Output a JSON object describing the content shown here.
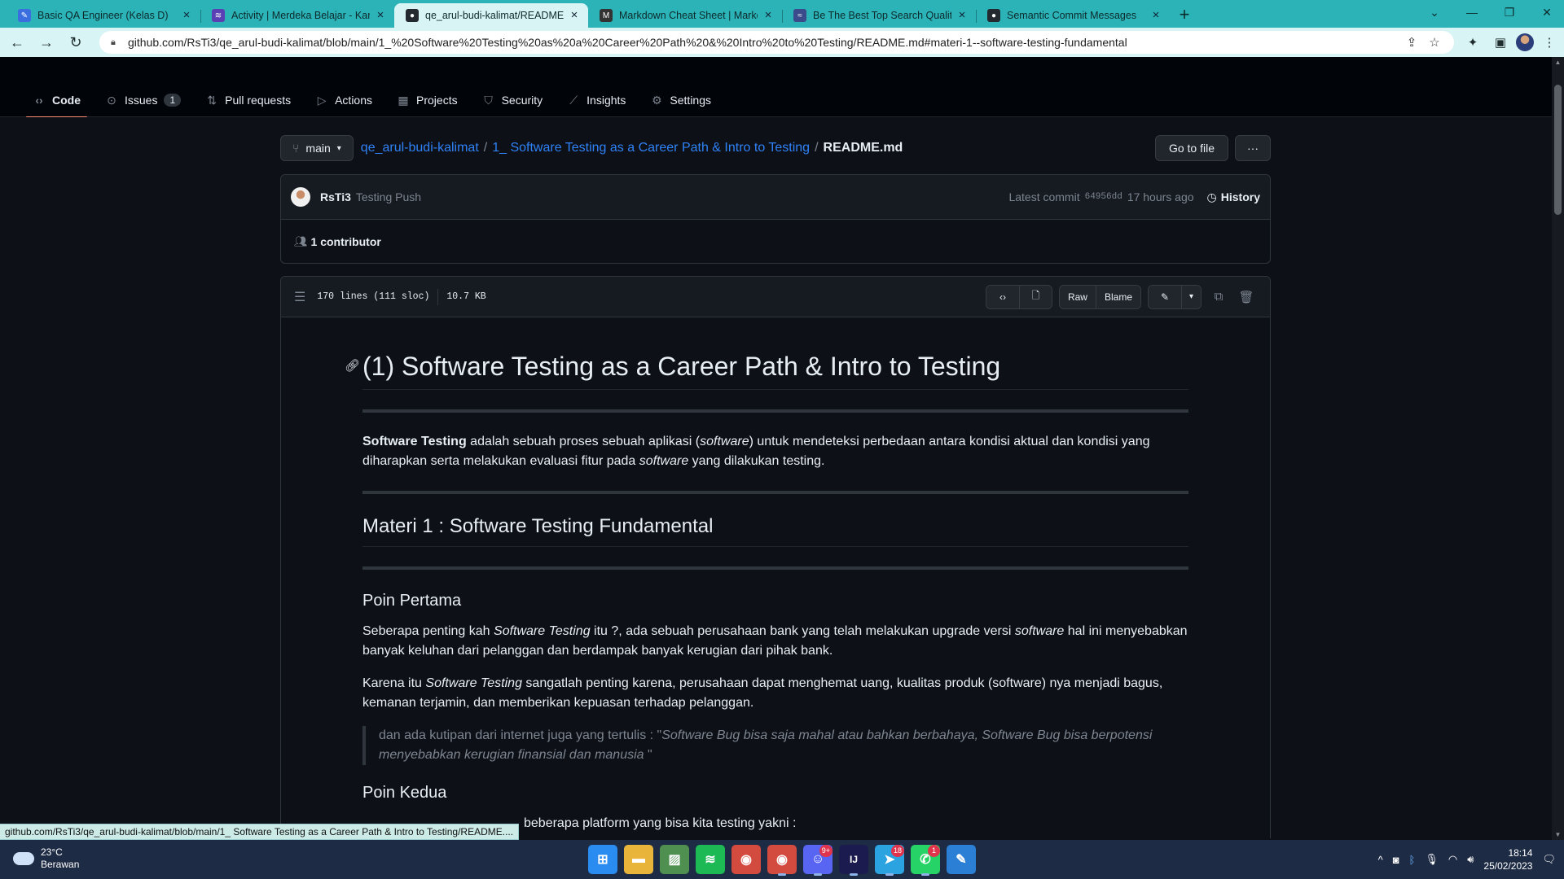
{
  "browser": {
    "tabs": [
      {
        "title": "Basic QA Engineer (Kelas D)",
        "fav": "feather-icon",
        "color": "#3b6fe0"
      },
      {
        "title": "Activity | Merdeka Belajar - Kamp",
        "fav": "mb-icon",
        "color": "#5a3fb5"
      },
      {
        "title": "qe_arul-budi-kalimat/README.m",
        "fav": "github-icon",
        "color": "#24292f",
        "active": true
      },
      {
        "title": "Markdown Cheat Sheet | Markdo",
        "fav": "markdown-icon",
        "color": "#333333"
      },
      {
        "title": "Be The Best Top Search Quality E",
        "fav": "quality-icon",
        "color": "#3a4a8a"
      },
      {
        "title": "Semantic Commit Messages",
        "fav": "github-icon",
        "color": "#24292f"
      }
    ],
    "url": "github.com/RsTi3/qe_arul-budi-kalimat/blob/main/1_%20Software%20Testing%20as%20a%20Career%20Path%20&%20Intro%20to%20Testing/README.md#materi-1--software-testing-fundamental"
  },
  "repo_nav": [
    {
      "label": "Code",
      "icon": "code-icon",
      "active": true
    },
    {
      "label": "Issues",
      "icon": "issue-icon",
      "count": "1"
    },
    {
      "label": "Pull requests",
      "icon": "pull-request-icon"
    },
    {
      "label": "Actions",
      "icon": "play-icon"
    },
    {
      "label": "Projects",
      "icon": "table-icon"
    },
    {
      "label": "Security",
      "icon": "shield-icon"
    },
    {
      "label": "Insights",
      "icon": "graph-icon"
    },
    {
      "label": "Settings",
      "icon": "gear-icon"
    }
  ],
  "file": {
    "branch": "main",
    "repo": "qe_arul-budi-kalimat",
    "folder": "1_ Software Testing as a Career Path & Intro to Testing",
    "filename": "README.md",
    "go_to_file": "Go to file",
    "more": "···"
  },
  "commit": {
    "author": "RsTi3",
    "message": "Testing Push",
    "latest_label": "Latest commit",
    "sha": "64956dd",
    "time": "17 hours ago",
    "history": "History",
    "contributors": "1 contributor"
  },
  "file_header": {
    "lines": "170 lines (111 sloc)",
    "size": "10.7 KB",
    "raw": "Raw",
    "blame": "Blame"
  },
  "readme": {
    "h1": "(1) Software Testing as a Career Path & Intro to Testing",
    "intro_strong": "Software Testing",
    "intro_a": " adalah sebuah proses sebuah aplikasi (",
    "intro_em1": "software",
    "intro_b": ") untuk mendeteksi perbedaan antara kondisi aktual dan kondisi yang diharapkan serta melakukan evaluasi fitur pada ",
    "intro_em2": "software",
    "intro_c": " yang dilakukan testing.",
    "h2": "Materi 1 : Software Testing Fundamental",
    "h3a": "Poin Pertama",
    "p1_a": "Seberapa penting kah ",
    "p1_em1": "Software Testing",
    "p1_b": " itu ?, ada sebuah perusahaan bank yang telah melakukan upgrade versi ",
    "p1_em2": "software",
    "p1_c": " hal ini menyebabkan banyak keluhan dari pelanggan dan berdampak banyak kerugian dari pihak bank.",
    "p2_a": "Karena itu ",
    "p2_em": "Software Testing",
    "p2_b": " sangatlah penting karena, perusahaan dapat menghemat uang, kualitas produk (software) nya menjadi bagus, kemanan terjamin, dan memberikan kepuasan terhadap pelanggan.",
    "quote_a": "dan ada kutipan dari internet juga yang tertulis : \"",
    "quote_em": "Software Bug bisa saja mahal atau bahkan berbahaya, Software Bug bisa berpotensi menyebabkan kerugian finansial dan manusia",
    "quote_b": " \"",
    "h3b": "Poin Kedua",
    "p3": "beberapa platform yang bisa kita testing yakni :"
  },
  "status_link": "github.com/RsTi3/qe_arul-budi-kalimat/blob/main/1_ Software Testing as a Career Path & Intro to Testing/README....",
  "taskbar": {
    "temp": "23°C",
    "weather": "Berawan",
    "apps": [
      {
        "name": "windows-start-icon",
        "color": "#2a8cf0"
      },
      {
        "name": "file-explorer-icon",
        "color": "#e8b53a"
      },
      {
        "name": "photos-icon",
        "color": "#4f8f4f"
      },
      {
        "name": "spotify-icon",
        "color": "#1db954"
      },
      {
        "name": "chrome-icon",
        "color": "#d34b3e"
      },
      {
        "name": "chrome-profile-icon",
        "color": "#d34b3e",
        "running": true
      },
      {
        "name": "discord-icon",
        "color": "#5865f2",
        "badge": "9+",
        "running": true
      },
      {
        "name": "intellij-icon",
        "color": "#1b1b4f",
        "running": true
      },
      {
        "name": "telegram-icon",
        "color": "#2aa3e0",
        "badge": "18",
        "running": true
      },
      {
        "name": "whatsapp-icon",
        "color": "#25d366",
        "badge": "1",
        "running": true
      },
      {
        "name": "paint-icon",
        "color": "#2b7fd4"
      }
    ],
    "time": "18:14",
    "date": "25/02/2023"
  }
}
